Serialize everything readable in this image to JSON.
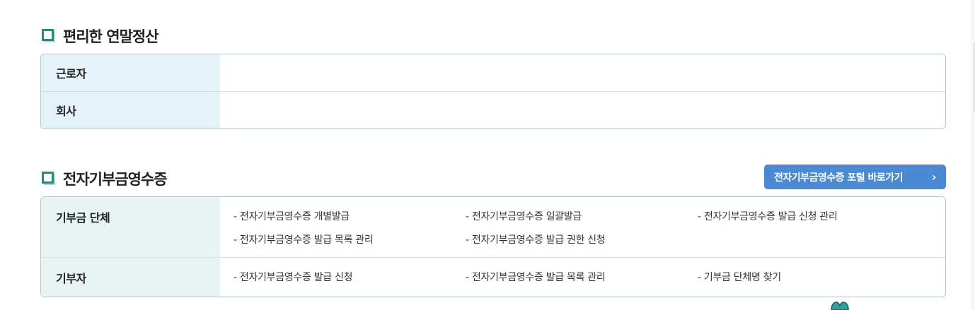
{
  "sections": {
    "easy_settlement": {
      "title": "편리한 연말정산",
      "rows": [
        {
          "label": "근로자"
        },
        {
          "label": "회사"
        }
      ]
    },
    "donation_receipt": {
      "title": "전자기부금영수증",
      "portal_button": {
        "label": "전자기부금영수증 포털 바로가기",
        "icon": "chevron-right-icon"
      },
      "rows": [
        {
          "label": "기부금 단체",
          "links": [
            "- 전자기부금영수증 개별발급",
            "- 전자기부금영수증 일괄발급",
            "- 전자기부금영수증 발급 신청 관리",
            "- 전자기부금영수증 발급 목록 관리",
            "- 전자기부금영수증 발급 권한 신청"
          ]
        },
        {
          "label": "기부자",
          "links": [
            "- 전자기부금영수증 발급 신청",
            "- 전자기부금영수증 발급 목록 관리",
            "- 기부금 단체명 찾기"
          ]
        }
      ]
    }
  },
  "colors": {
    "accent_teal": "#15918d",
    "button_blue": "#4b8ad3",
    "header_cell_blue": "#e4f2f9",
    "header_cell_teal": "#e7f4f3"
  }
}
